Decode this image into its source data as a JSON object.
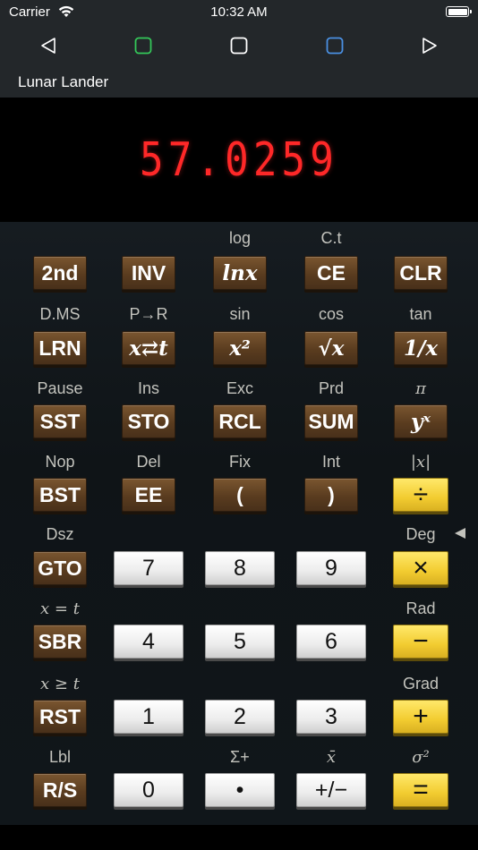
{
  "status_bar": {
    "carrier": "Carrier",
    "time": "10:32 AM",
    "wifi_icon": "wifi-icon",
    "battery_icon": "battery-icon"
  },
  "nav_bar": {
    "buttons": [
      "back-triangle-icon",
      "square-green-icon",
      "square-white-icon",
      "square-blue-icon",
      "forward-triangle-icon"
    ]
  },
  "app": {
    "title": "Lunar Lander"
  },
  "display": {
    "value": "57.0259",
    "color": "#ff2828"
  },
  "keypad": {
    "rows": [
      {
        "labels": [
          "",
          "",
          "log",
          "C.t",
          ""
        ],
        "keys": [
          "2nd",
          "INV",
          "lnx",
          "CE",
          "CLR"
        ]
      },
      {
        "labels": [
          "D.MS",
          "P→R",
          "sin",
          "cos",
          "tan"
        ],
        "keys": [
          "LRN",
          "x⇄t",
          "x²",
          "√x",
          "1/x"
        ]
      },
      {
        "labels": [
          "Pause",
          "Ins",
          "Exc",
          "Prd",
          "π"
        ],
        "keys": [
          "SST",
          "STO",
          "RCL",
          "SUM",
          "yˣ"
        ]
      },
      {
        "labels": [
          "Nop",
          "Del",
          "Fix",
          "Int",
          "|x|"
        ],
        "keys": [
          "BST",
          "EE",
          "(",
          ")",
          "÷"
        ]
      },
      {
        "labels": [
          "Dsz",
          "",
          "",
          "",
          "Deg"
        ],
        "keys": [
          "GTO",
          "7",
          "8",
          "9",
          "×"
        ]
      },
      {
        "labels": [
          "x = t",
          "",
          "",
          "",
          "Rad"
        ],
        "keys": [
          "SBR",
          "4",
          "5",
          "6",
          "−"
        ]
      },
      {
        "labels": [
          "x ≥ t",
          "",
          "",
          "",
          "Grad"
        ],
        "keys": [
          "RST",
          "1",
          "2",
          "3",
          "+"
        ]
      },
      {
        "labels": [
          "Lbl",
          "",
          "Σ+",
          "x̄",
          "σ²"
        ],
        "keys": [
          "R/S",
          "0",
          "•",
          "+/−",
          "="
        ]
      }
    ],
    "colors": {
      "brown": "#5a3c1f",
      "white": "#f2f2f2",
      "yellow": "#f2cc30",
      "label": "#c3c3bd"
    }
  }
}
